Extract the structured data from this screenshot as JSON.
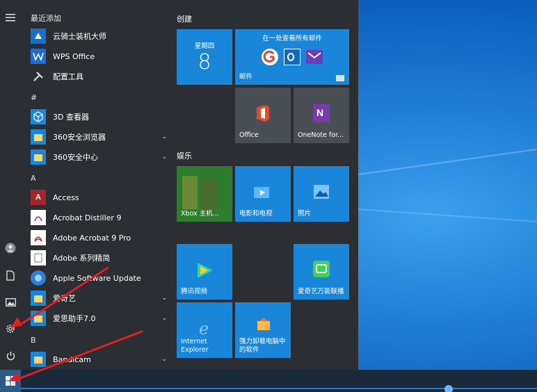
{
  "rail": {
    "items": [
      "hamburger-icon",
      "user-icon",
      "document-icon",
      "pictures-icon",
      "gear-icon",
      "power-icon"
    ]
  },
  "applist": {
    "sections": [
      {
        "header": "最近添加"
      },
      {
        "header": "#"
      },
      {
        "header": "A"
      },
      {
        "header": "B"
      }
    ],
    "apps": [
      {
        "label": "云骑士装机大师"
      },
      {
        "label": "WPS Office"
      },
      {
        "label": "配置工具"
      },
      {
        "label": "3D 查看器"
      },
      {
        "label": "360安全浏览器"
      },
      {
        "label": "360安全中心"
      },
      {
        "label": "Access"
      },
      {
        "label": "Acrobat Distiller 9"
      },
      {
        "label": "Adobe Acrobat 9 Pro"
      },
      {
        "label": "Adobe 系列精简"
      },
      {
        "label": "Apple Software Update"
      },
      {
        "label": "爱奇艺"
      },
      {
        "label": "爱思助手7.0"
      },
      {
        "label": "Bandicam"
      }
    ]
  },
  "tiles": {
    "groups": [
      {
        "header": "创建"
      },
      {
        "header": "娱乐"
      }
    ],
    "calendar": {
      "weekday": "星期四",
      "day": "8"
    },
    "mail": {
      "top": "在一处查看所有邮件",
      "label": "邮件"
    },
    "office": {
      "label": "Office"
    },
    "onenote": {
      "label": "OneNote for..."
    },
    "xbox": {
      "label": "Xbox 主机..."
    },
    "movies": {
      "label": "电影和电视"
    },
    "photos": {
      "label": "照片"
    },
    "tencent": {
      "label": "腾讯视频"
    },
    "iqiyi": {
      "label": "爱奇艺万能联播"
    },
    "ie": {
      "label": "Internet Explorer"
    },
    "uninstall": {
      "label": "强力卸载电脑中的软件"
    }
  },
  "colors": {
    "menu_bg": "#2b2f33",
    "tile_blue": "#1a86d9",
    "accent_red": "#e02020"
  }
}
